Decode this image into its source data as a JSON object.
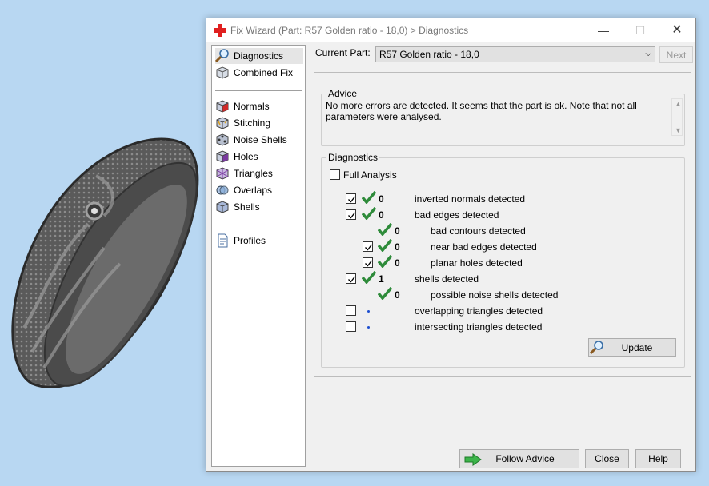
{
  "window": {
    "title": "Fix Wizard (Part: R57 Golden ratio - 18,0) > Diagnostics",
    "min": "—",
    "max": "☐",
    "close": "✕"
  },
  "sidebar": {
    "items": [
      {
        "label": "Diagnostics",
        "icon": "magnifier-icon",
        "selected": true
      },
      {
        "label": "Combined Fix",
        "icon": "box-icon"
      },
      {
        "label": "Normals",
        "icon": "normals-cube-icon"
      },
      {
        "label": "Stitching",
        "icon": "stitching-cube-icon"
      },
      {
        "label": "Noise Shells",
        "icon": "noise-shells-icon"
      },
      {
        "label": "Holes",
        "icon": "holes-cube-icon"
      },
      {
        "label": "Triangles",
        "icon": "triangles-icon"
      },
      {
        "label": "Overlaps",
        "icon": "overlaps-icon"
      },
      {
        "label": "Shells",
        "icon": "shells-icon"
      },
      {
        "label": "Profiles",
        "icon": "document-icon"
      }
    ]
  },
  "current_part": {
    "label": "Current Part:",
    "value": "R57 Golden ratio - 18,0",
    "next_button": "Next"
  },
  "advice": {
    "title": "Advice",
    "text": "No more errors are detected. It seems that the part is ok. Note that not all parameters were analysed."
  },
  "diagnostics": {
    "title": "Diagnostics",
    "full_analysis": {
      "label": "Full Analysis",
      "checked": false
    },
    "rows": [
      {
        "checked": true,
        "status": "ok",
        "count": "0",
        "label": "inverted normals detected"
      },
      {
        "checked": true,
        "status": "ok",
        "count": "0",
        "label": "bad edges detected"
      },
      {
        "checked": null,
        "status": "ok",
        "count": "0",
        "label": "bad contours detected"
      },
      {
        "checked": true,
        "status": "ok",
        "count": "0",
        "label": "near bad edges detected"
      },
      {
        "checked": true,
        "status": "ok",
        "count": "0",
        "label": "planar holes detected"
      },
      {
        "checked": true,
        "status": "ok",
        "count": "1",
        "label": "shells detected"
      },
      {
        "checked": null,
        "status": "ok",
        "count": "0",
        "label": "possible noise shells detected"
      },
      {
        "checked": false,
        "status": "pending",
        "count": "",
        "label": "overlapping triangles detected"
      },
      {
        "checked": false,
        "status": "pending",
        "count": "",
        "label": "intersecting triangles detected"
      }
    ],
    "update_button": "Update"
  },
  "footer": {
    "follow_advice": "Follow Advice",
    "close": "Close",
    "help": "Help"
  },
  "colors": {
    "check_green": "#2e8b3a",
    "pending_blue": "#1e4fd0",
    "background": "#b8d7f2"
  }
}
